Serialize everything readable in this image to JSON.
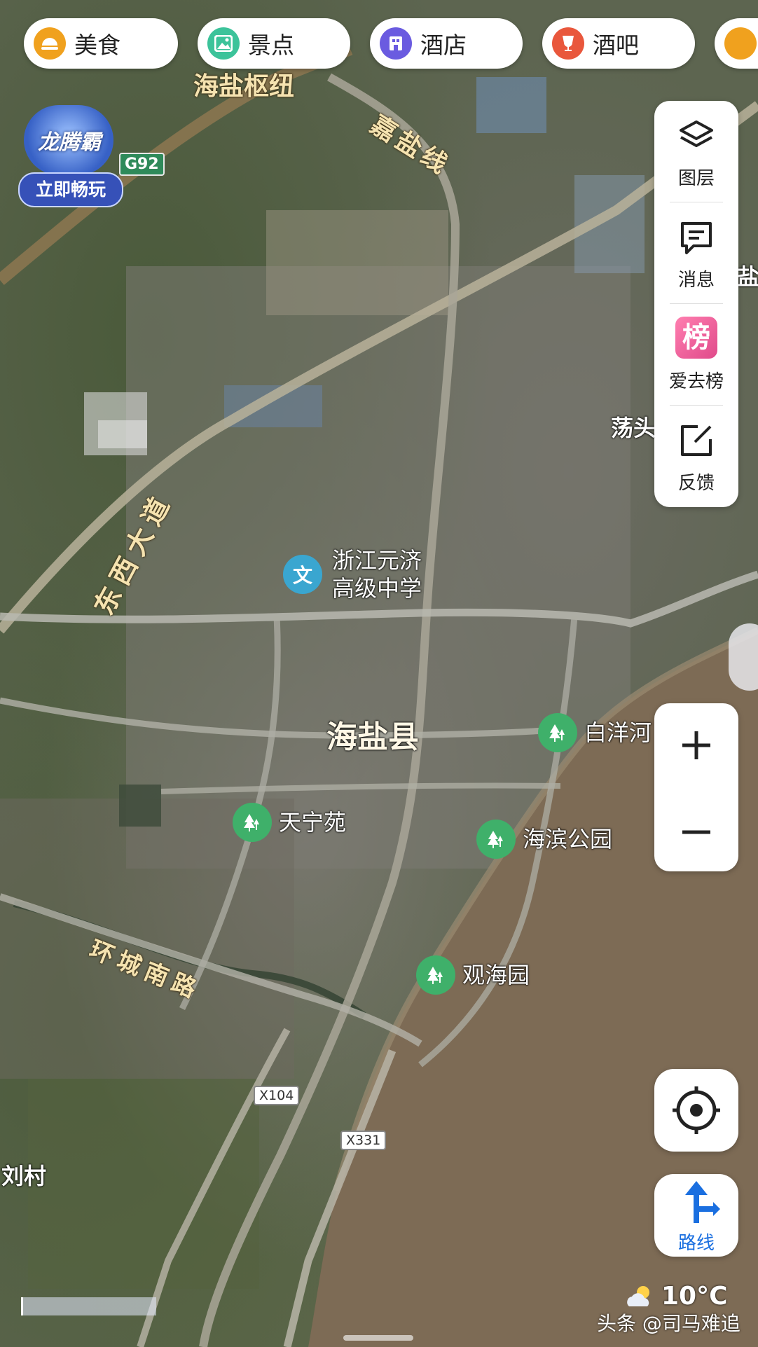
{
  "categories": [
    {
      "label": "美食",
      "icon": "food-icon",
      "color": "#f0a11e"
    },
    {
      "label": "景点",
      "icon": "scenic-icon",
      "color": "#3cc39a"
    },
    {
      "label": "酒店",
      "icon": "hotel-icon",
      "color": "#6a5be0"
    },
    {
      "label": "酒吧",
      "icon": "bar-icon",
      "color": "#e9573c"
    }
  ],
  "toolbar": {
    "layers": "图层",
    "messages": "消息",
    "ranking": "爱去榜",
    "ranking_badge": "榜",
    "feedback": "反馈"
  },
  "zoom": {
    "in": "+",
    "out": "−"
  },
  "route": {
    "label": "路线"
  },
  "promo": {
    "title": "龙腾霸",
    "badge": "立即畅玩"
  },
  "map": {
    "county": "海盐县",
    "hub": "海盐枢纽",
    "places": {
      "dangtou": "荡头",
      "liucun": "刘村",
      "edge_right": "盐民"
    },
    "roads": {
      "jiayan": "嘉盐线",
      "dongxi": "东西大道",
      "huancheng_south": "环城南路"
    },
    "shields": {
      "g92": "G92",
      "x104": "X104",
      "x331": "X331"
    },
    "pois": [
      {
        "name_line1": "浙江元济",
        "name_line2": "高级中学",
        "type": "school",
        "icon": "school-icon",
        "glyph": "文",
        "color": "#3aa6d0"
      },
      {
        "name_line1": "白洋河",
        "name_line2": "",
        "type": "park",
        "icon": "park-icon",
        "color": "#3fb06a"
      },
      {
        "name_line1": "天宁苑",
        "name_line2": "",
        "type": "park",
        "icon": "park-icon",
        "color": "#3fb06a"
      },
      {
        "name_line1": "海滨公园",
        "name_line2": "",
        "type": "park",
        "icon": "park-icon",
        "color": "#3fb06a"
      },
      {
        "name_line1": "观海园",
        "name_line2": "",
        "type": "park",
        "icon": "park-icon",
        "color": "#3fb06a"
      }
    ]
  },
  "weather": {
    "temp": "10°C",
    "icon": "partly-cloudy-icon"
  },
  "watermark": "头条 @司马难追"
}
